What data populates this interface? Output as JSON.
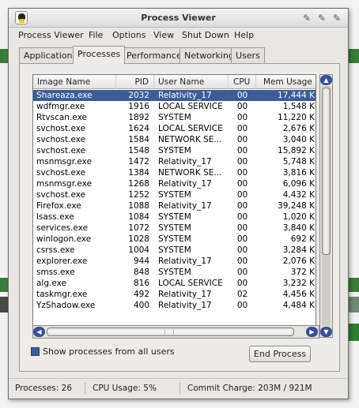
{
  "window": {
    "title": "Process Viewer"
  },
  "menu": [
    "Process Viewer",
    "File",
    "Options",
    "View",
    "Shut Down",
    "Help"
  ],
  "tabs": [
    "Applications",
    "Processes",
    "Performance",
    "Networking",
    "Users"
  ],
  "table": {
    "columns": [
      "Image Name",
      "PID",
      "User Name",
      "CPU",
      "Mem Usage"
    ],
    "rows": [
      [
        "Shareaza.exe",
        "2032",
        "Relativity_17",
        "00",
        "17,444 K"
      ],
      [
        "wdfmgr.exe",
        "1916",
        "LOCAL SERVICE",
        "00",
        "1,548 K"
      ],
      [
        "Rtvscan.exe",
        "1892",
        "SYSTEM",
        "00",
        "11,220 K"
      ],
      [
        "svchost.exe",
        "1624",
        "LOCAL SERVICE",
        "00",
        "2,676 K"
      ],
      [
        "svchost.exe",
        "1584",
        "NETWORK SE...",
        "00",
        "3,040 K"
      ],
      [
        "svchost.exe",
        "1548",
        "SYSTEM",
        "00",
        "15,892 K"
      ],
      [
        "msnmsgr.exe",
        "1472",
        "Relativity_17",
        "00",
        "5,748 K"
      ],
      [
        "svchost.exe",
        "1384",
        "NETWORK SE...",
        "00",
        "3,816 K"
      ],
      [
        "msnmsgr.exe",
        "1268",
        "Relativity_17",
        "00",
        "6,096 K"
      ],
      [
        "svchost.exe",
        "1252",
        "SYSTEM",
        "00",
        "4,432 K"
      ],
      [
        "Firefox.exe",
        "1088",
        "Relativity_17",
        "00",
        "39,248 K"
      ],
      [
        "lsass.exe",
        "1084",
        "SYSTEM",
        "00",
        "1,020 K"
      ],
      [
        "services.exe",
        "1072",
        "SYSTEM",
        "00",
        "3,840 K"
      ],
      [
        "winlogon.exe",
        "1028",
        "SYSTEM",
        "00",
        "692 K"
      ],
      [
        "csrss.exe",
        "1004",
        "SYSTEM",
        "00",
        "3,284 K"
      ],
      [
        "explorer.exe",
        "944",
        "Relativity_17",
        "00",
        "2,076 K"
      ],
      [
        "smss.exe",
        "848",
        "SYSTEM",
        "00",
        "372 K"
      ],
      [
        "alg.exe",
        "816",
        "LOCAL SERVICE",
        "00",
        "3,232 K"
      ],
      [
        "taskmgr.exe",
        "492",
        "Relativity_17",
        "02",
        "4,456 K"
      ],
      [
        "YzShadow.exe",
        "400",
        "Relativity_17",
        "00",
        "4,484 K"
      ]
    ]
  },
  "options": {
    "show_all_label": "Show processes from all users"
  },
  "buttons": {
    "end_process": "End Process"
  },
  "status": {
    "processes": "Processes: 26",
    "cpu": "CPU Usage: 5%",
    "commit": "Commit Charge: 203M / 921M"
  }
}
